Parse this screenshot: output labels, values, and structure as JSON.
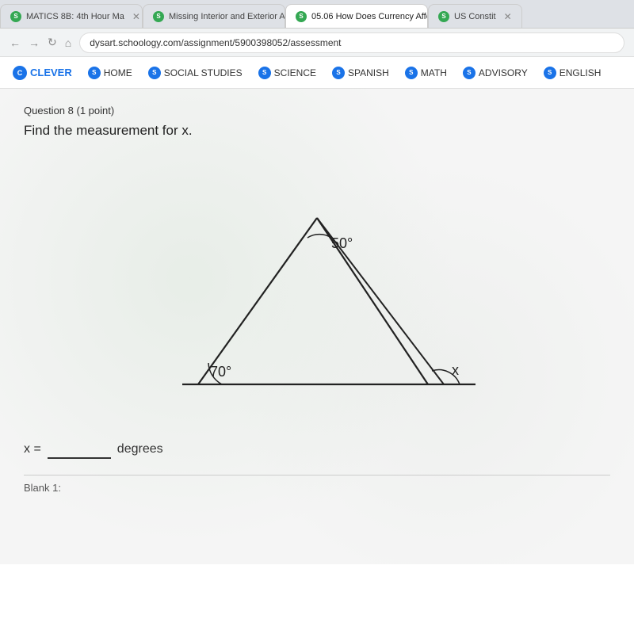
{
  "browser": {
    "tabs": [
      {
        "label": "MATICS 8B: 4th Hour Ma",
        "active": false,
        "iconLetter": "S",
        "iconColor": "green"
      },
      {
        "label": "Missing Interior and Exterior Ang",
        "active": false,
        "iconLetter": "S",
        "iconColor": "green"
      },
      {
        "label": "05.06 How Does Currency Affec",
        "active": true,
        "iconLetter": "S",
        "iconColor": "green"
      },
      {
        "label": "US Constit",
        "active": false,
        "iconLetter": "S",
        "iconColor": "green"
      }
    ],
    "addressBar": "dysart.schoology.com/assignment/5900398052/assessment"
  },
  "nav": {
    "items": [
      {
        "label": "CLEVER",
        "icon": "C",
        "iconBg": "#1a73e8",
        "isBold": true
      },
      {
        "label": "HOME",
        "icon": "S",
        "iconBg": "#34a853"
      },
      {
        "label": "SOCIAL STUDIES",
        "icon": "S",
        "iconBg": "#34a853"
      },
      {
        "label": "SCIENCE",
        "icon": "S",
        "iconBg": "#34a853"
      },
      {
        "label": "SPANISH",
        "icon": "S",
        "iconBg": "#34a853"
      },
      {
        "label": "MATH",
        "icon": "S",
        "iconBg": "#34a853"
      },
      {
        "label": "ADVISORY",
        "icon": "S",
        "iconBg": "#34a853"
      },
      {
        "label": "ENGLISH",
        "icon": "S",
        "iconBg": "#34a853"
      }
    ]
  },
  "question": {
    "header": "Question 8 (1 point)",
    "text": "Find the measurement for x.",
    "diagram": {
      "angle_top": "50°",
      "angle_bottom_left": "70°",
      "angle_x": "x"
    },
    "answer_label": "x =",
    "answer_unit": "degrees",
    "blank_label": "Blank 1:"
  }
}
